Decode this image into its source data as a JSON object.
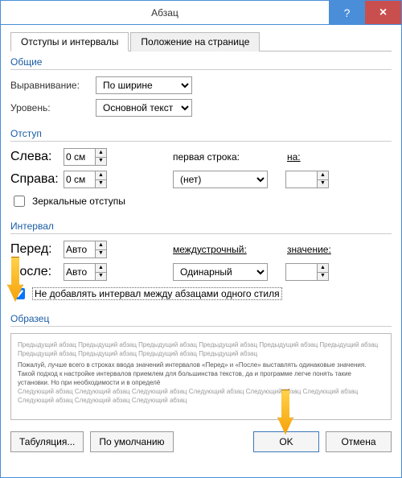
{
  "title": "Абзац",
  "tabs": {
    "t1": "Отступы и интервалы",
    "t2": "Положение на странице"
  },
  "group_general": "Общие",
  "align_label": "Выравнивание:",
  "align_value": "По ширине",
  "level_label": "Уровень:",
  "level_value": "Основной текст",
  "group_indent": "Отступ",
  "left_label": "Слева:",
  "left_value": "0 см",
  "right_label": "Справа:",
  "right_value": "0 см",
  "firstline_label": "первая строка:",
  "firstline_value": "(нет)",
  "by1_label": "на:",
  "mirror_label": "Зеркальные отступы",
  "group_spacing": "Интервал",
  "before_label": "Перед:",
  "before_value": "Авто",
  "after_label": "После:",
  "after_value": "Авто",
  "line_label": "междустрочный:",
  "line_value": "Одинарный",
  "by2_label": "значение:",
  "nosame_label": "Не добавлять интервал между абзацами одного стиля",
  "group_preview": "Образец",
  "preview_prev": "Предыдущий абзац Предыдущий абзац Предыдущий абзац Предыдущий абзац Предыдущий абзац Предыдущий абзац Предыдущий абзац Предыдущий абзац Предыдущий абзац Предыдущий абзац",
  "preview_main": "Пожалуй, лучше всего в строках ввода значений интервалов «Перед» и «После» выставлять одинаковые значения. Такой подход к настройке интервалов приемлем для большинства текстов, да и программе легче понять такие установки. Но при необходимости и в определё",
  "preview_next": "Следующий абзац Следующий абзац Следующий абзац Следующий абзац Следующий абзац Следующий абзац Следующий абзац Следующий абзац Следующий абзац",
  "btn_tabs": "Табуляция...",
  "btn_default": "По умолчанию",
  "btn_ok": "OK",
  "btn_cancel": "Отмена"
}
